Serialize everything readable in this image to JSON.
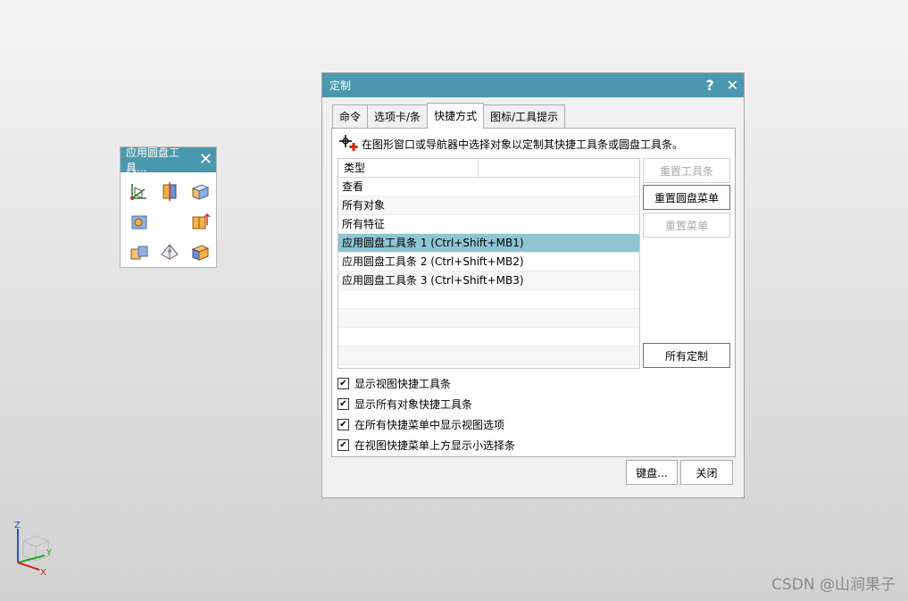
{
  "radial_toolbar": {
    "title": "应用圆盘工具...",
    "icons": [
      "wcs-icon",
      "split-body-icon",
      "block-icon",
      "hole-icon",
      "extrude-icon",
      "boolean-icon",
      "draft-icon",
      "emboss-icon"
    ]
  },
  "dialog": {
    "title": "定制",
    "help_label": "?",
    "close_label": "✕",
    "tabs": [
      "命令",
      "选项卡/条",
      "快捷方式",
      "图标/工具提示"
    ],
    "active_tab": "快捷方式",
    "hint": "在图形窗口或导航器中选择对象以定制其快捷工具条或圆盘工具条。",
    "list": {
      "header": "类型",
      "items": [
        "查看",
        "所有对象",
        "所有特征",
        "应用圆盘工具条 1 (Ctrl+Shift+MB1)",
        "应用圆盘工具条 2 (Ctrl+Shift+MB2)",
        "应用圆盘工具条 3 (Ctrl+Shift+MB3)"
      ],
      "selected_index": 3
    },
    "side_buttons": {
      "reset_toolbar": "重置工具条",
      "reset_radial": "重置圆盘菜单",
      "reset_menu": "重置菜单",
      "all_custom": "所有定制"
    },
    "checkboxes": [
      {
        "label": "显示视图快捷工具条",
        "checked": true
      },
      {
        "label": "显示所有对象快捷工具条",
        "checked": true
      },
      {
        "label": "在所有快捷菜单中显示视图选项",
        "checked": true
      },
      {
        "label": "在视图快捷菜单上方显示小选择条",
        "checked": true
      }
    ],
    "footer": {
      "keyboard": "键盘...",
      "close": "关闭"
    }
  },
  "triad": {
    "z": "Z",
    "y": "Y",
    "x": "X"
  },
  "watermark": "CSDN @山涧果子",
  "colors": {
    "titlebar": "#4a98ad",
    "selection": "#8ec5d3"
  }
}
